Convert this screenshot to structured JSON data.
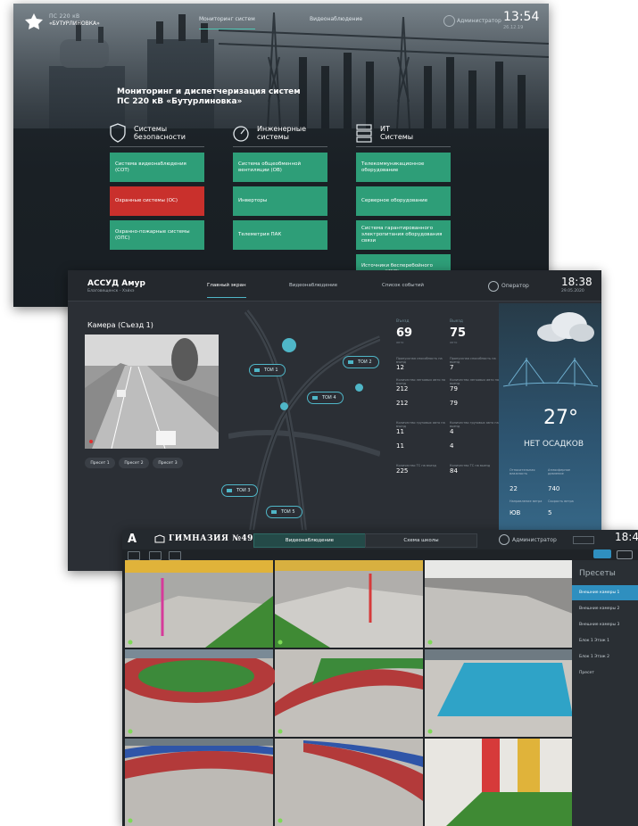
{
  "screen1": {
    "brand_line1": "ПС 220 кВ",
    "brand_line2": "«БУТУРЛИНОВКА»",
    "nav": [
      "Мониторинг систем",
      "Видеонаблюдение"
    ],
    "user": "Администратор",
    "time": "13:54",
    "date": "26.12.19",
    "title": "Мониторинг и диспетчеризация систем ПС 220 кВ «Бутурлиновка»",
    "columns": [
      {
        "title": "Системы безопасности",
        "icon": "shield-icon",
        "tiles": [
          "Система видеонаблюдения (СОТ)",
          "Охранные системы (ОС)",
          "Охранно-пожарные системы (ОПС)"
        ]
      },
      {
        "title": "Инженерные системы",
        "icon": "gauge-icon",
        "tiles": [
          "Система общеобменной вентиляции (ОВ)",
          "Инверторы",
          "Телеметрия ПАК"
        ]
      },
      {
        "title": "ИТ Системы",
        "icon": "server-icon",
        "tiles": [
          "Телекоммуникационное оборудование",
          "Серверное оборудование",
          "Система гарантированного электропитания оборудования связи",
          "Источники бесперебойного питания (ИБП)"
        ]
      }
    ],
    "colors": {
      "tile_green": "#2e9e78",
      "tile_red": "#c9302c",
      "accent": "#4fc6b4"
    }
  },
  "screen2": {
    "app_title": "АССУД Амур",
    "app_sub": "Благовещенск - Хэйхэ",
    "nav": [
      "Главный экран",
      "Видеонаблюдение",
      "Список событий"
    ],
    "user": "Оператор",
    "time": "18:38",
    "date": "29.05.2020",
    "camera_title": "Камера  (Съезд 1)",
    "presets": [
      "Пресет 1",
      "Пресет 2",
      "Пресет 3"
    ],
    "map_labels": [
      "ТОИ 1",
      "ТОИ 2",
      "ТОИ 4",
      "ТОИ 3",
      "ТОИ 5"
    ],
    "stats": [
      {
        "header": "Въезд",
        "total": "69",
        "unit": "авто",
        "rows": [
          [
            "Пропускная способность на въезд",
            "12"
          ],
          [
            "Количество легковых авто на въезд",
            "212"
          ],
          [
            "",
            "212"
          ],
          [
            "Количество грузовых авто на въезд",
            "11"
          ],
          [
            "",
            "11"
          ],
          [
            "Количество ТС на въезд",
            "225"
          ]
        ]
      },
      {
        "header": "Выезд",
        "total": "75",
        "unit": "авто",
        "rows": [
          [
            "Пропускная способность на выезд",
            "7"
          ],
          [
            "Количество легковых авто на выезд",
            "79"
          ],
          [
            "",
            "79"
          ],
          [
            "Количество грузовых авто на выезд",
            "4"
          ],
          [
            "",
            "4"
          ],
          [
            "Количество ТС на выезд",
            "84"
          ]
        ]
      }
    ],
    "weather": {
      "temp": "27°",
      "precip": "НЕТ ОСАДКОВ",
      "humidity_label": "Относительная влажность",
      "humidity": "22",
      "pressure_label": "Атмосферное давление",
      "pressure": "740",
      "wind_dir_label": "Направление ветра",
      "wind_dir": "ЮВ",
      "wind_speed_label": "Скорость ветра",
      "wind_speed": "5"
    },
    "colors": {
      "accent": "#4fb6c7"
    }
  },
  "screen3": {
    "logo_letter": "A",
    "school": "ГИМНАЗИЯ №49",
    "tabs": [
      "Видеонаблюдение",
      "Схема школы"
    ],
    "user": "Администратор",
    "time": "18:4",
    "presets_title": "Пресеты",
    "presets": [
      "Внешние камеры 1",
      "Внешние камеры 2",
      "Внешние камеры 3",
      "Блок 1 Этаж 1",
      "Блок 1 Этаж 2",
      "Пресет"
    ],
    "colors": {
      "active": "#2f8fbf",
      "tab_active": "#244a48"
    }
  }
}
